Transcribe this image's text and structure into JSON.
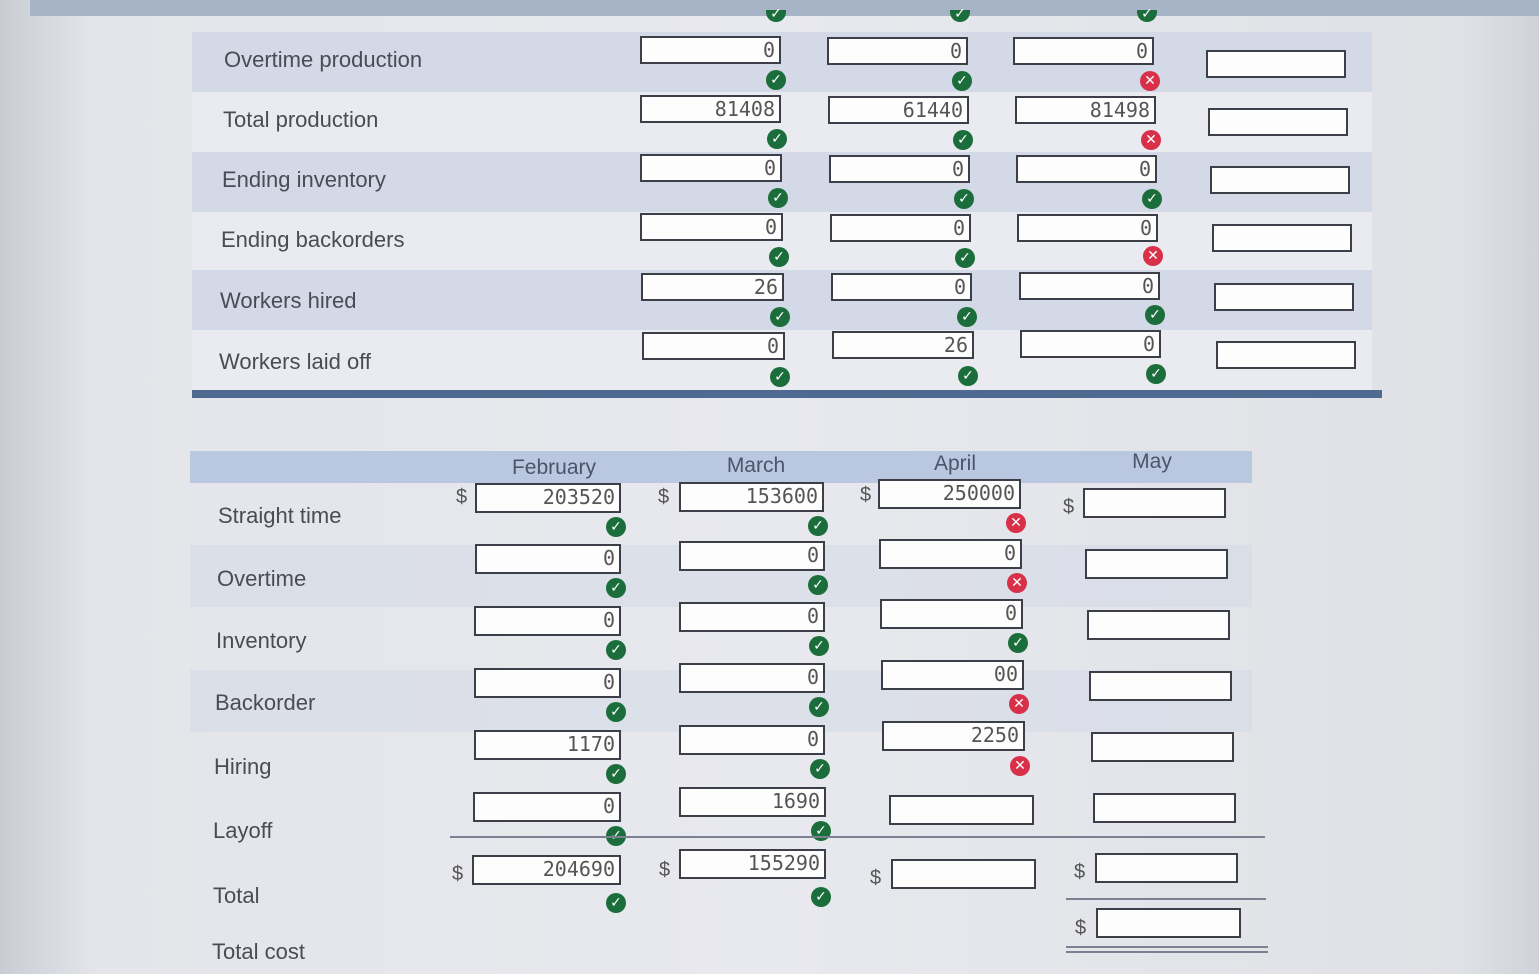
{
  "production_table": {
    "rows": [
      {
        "label": "Overtime production",
        "values": [
          "0",
          "0",
          "0",
          ""
        ],
        "status": [
          "ok",
          "ok",
          "bad"
        ]
      },
      {
        "label": "Total production",
        "values": [
          "81408",
          "61440",
          "81498",
          ""
        ],
        "status": [
          "ok",
          "ok",
          "bad"
        ]
      },
      {
        "label": "Ending inventory",
        "values": [
          "0",
          "0",
          "0",
          ""
        ],
        "status": [
          "ok",
          "ok",
          "ok"
        ]
      },
      {
        "label": "Ending backorders",
        "values": [
          "0",
          "0",
          "0",
          ""
        ],
        "status": [
          "ok",
          "ok",
          "bad"
        ]
      },
      {
        "label": "Workers hired",
        "values": [
          "26",
          "0",
          "0",
          ""
        ],
        "status": [
          "ok",
          "ok",
          "ok"
        ]
      },
      {
        "label": "Workers laid off",
        "values": [
          "0",
          "26",
          "0",
          ""
        ],
        "status": [
          "ok",
          "ok",
          "ok"
        ]
      }
    ]
  },
  "cost_table": {
    "months": [
      "February",
      "March",
      "April",
      "May"
    ],
    "currency": "$",
    "rows": [
      {
        "label": "Straight time",
        "values": [
          "203520",
          "153600",
          "250000",
          ""
        ],
        "status": [
          "ok",
          "ok",
          "bad",
          ""
        ]
      },
      {
        "label": "Overtime",
        "values": [
          "0",
          "0",
          "0",
          ""
        ],
        "status": [
          "ok",
          "ok",
          "bad",
          ""
        ]
      },
      {
        "label": "Inventory",
        "values": [
          "0",
          "0",
          "0",
          ""
        ],
        "status": [
          "ok",
          "ok",
          "ok",
          ""
        ]
      },
      {
        "label": "Backorder",
        "values": [
          "0",
          "0",
          "00",
          ""
        ],
        "status": [
          "ok",
          "ok",
          "bad",
          ""
        ]
      },
      {
        "label": "Hiring",
        "values": [
          "1170",
          "0",
          "2250",
          ""
        ],
        "status": [
          "ok",
          "ok",
          "bad",
          ""
        ]
      },
      {
        "label": "Layoff",
        "values": [
          "0",
          "1690",
          "",
          ""
        ],
        "status": [
          "ok",
          "ok",
          "",
          ""
        ]
      },
      {
        "label": "Total",
        "values": [
          "204690",
          "155290",
          "",
          ""
        ],
        "status": [
          "ok",
          "ok",
          "",
          ""
        ]
      }
    ],
    "total_cost_label": "Total cost",
    "total_cost_value": ""
  },
  "icons": {
    "ok": "check-circle-icon",
    "bad": "x-circle-icon"
  },
  "colors": {
    "ok": "#1b6e3b",
    "bad": "#d9304a",
    "header": "#b9c8e0",
    "divider": "#4e6a90"
  }
}
